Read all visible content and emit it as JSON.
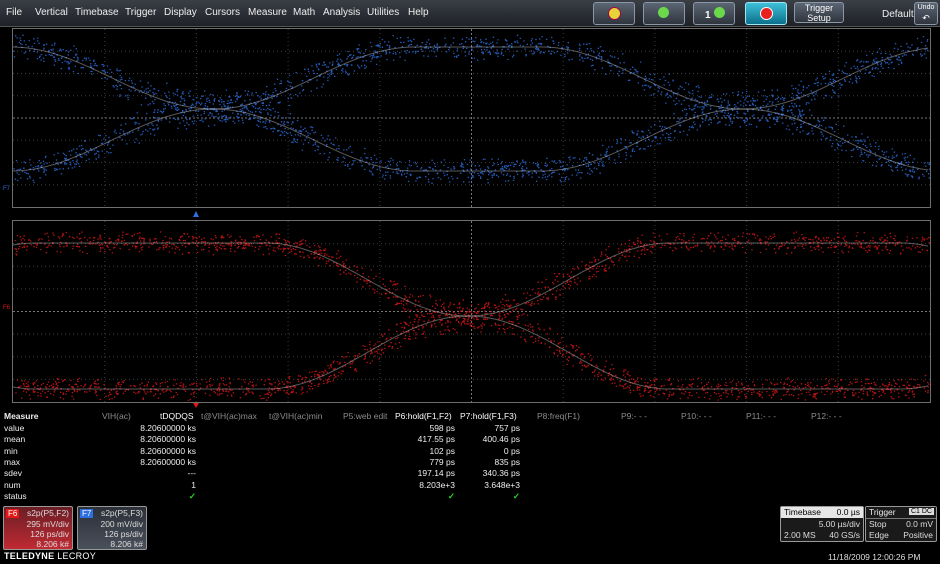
{
  "menu": [
    "File",
    "Vertical",
    "Timebase",
    "Trigger",
    "Display",
    "Cursors",
    "Measure",
    "Math",
    "Analysis",
    "Utilities",
    "Help"
  ],
  "toolbar": {
    "trigger_setup_line1": "Trigger",
    "trigger_setup_line2": "Setup",
    "toolbar_badge": "1",
    "default_label": "Default",
    "undo_label": "Undo"
  },
  "grid": {
    "top_channel_marker": "F7",
    "bottom_channel_marker": "F6",
    "top_color": "#2d6fe0",
    "bottom_color": "#e01818"
  },
  "measure": {
    "title": "Measure",
    "headers": [
      "VIH(ac)",
      "tDQDQS",
      "t@VIH(ac)max",
      "t@VIH(ac)min",
      "P5:web edit",
      "P6:hold(F1,F2)",
      "P7:hold(F1,F3)",
      "P8:freq(F1)",
      "P9:- - -",
      "P10:- - -",
      "P11:- - -",
      "P12:- - -"
    ],
    "rows": [
      {
        "label": "value",
        "p2": "8.20600000 ks",
        "p6": "598 ps",
        "p7": "757 ps"
      },
      {
        "label": "mean",
        "p2": "8.20600000 ks",
        "p6": "417.55 ps",
        "p7": "400.46 ps"
      },
      {
        "label": "min",
        "p2": "8.20600000 ks",
        "p6": "102 ps",
        "p7": "0 ps"
      },
      {
        "label": "max",
        "p2": "8.20600000 ks",
        "p6": "779 ps",
        "p7": "835 ps"
      },
      {
        "label": "sdev",
        "p2": "---",
        "p6": "197.14 ps",
        "p7": "340.36 ps"
      },
      {
        "label": "num",
        "p2": "1",
        "p6": "8.203e+3",
        "p7": "3.648e+3"
      },
      {
        "label": "status",
        "p2": "✓",
        "p6": "✓",
        "p7": "✓"
      }
    ]
  },
  "descriptors": {
    "f6": {
      "tag": "F6",
      "title": "s2p(P5,F2)",
      "line1": "295 mV/div",
      "line2": "126 ps/div",
      "line3": "8.206 k#"
    },
    "f7": {
      "tag": "F7",
      "title": "s2p(P5,F3)",
      "line1": "200 mV/div",
      "line2": "126 ps/div",
      "line3": "8.206 k#"
    }
  },
  "timebase": {
    "label": "Timebase",
    "delay": "0.0 µs",
    "per_div": "5.00 µs/div",
    "samples": "2.00 MS",
    "rate": "40 GS/s"
  },
  "trigger": {
    "label": "Trigger",
    "badge": "C1 DC",
    "mode": "Stop",
    "level": "0.0 mV",
    "type": "Edge",
    "slope": "Positive"
  },
  "footer": {
    "logo_bold": "TELEDYNE",
    "logo_light": "LECROY",
    "datetime": "11/18/2009 12:00:26 PM"
  }
}
